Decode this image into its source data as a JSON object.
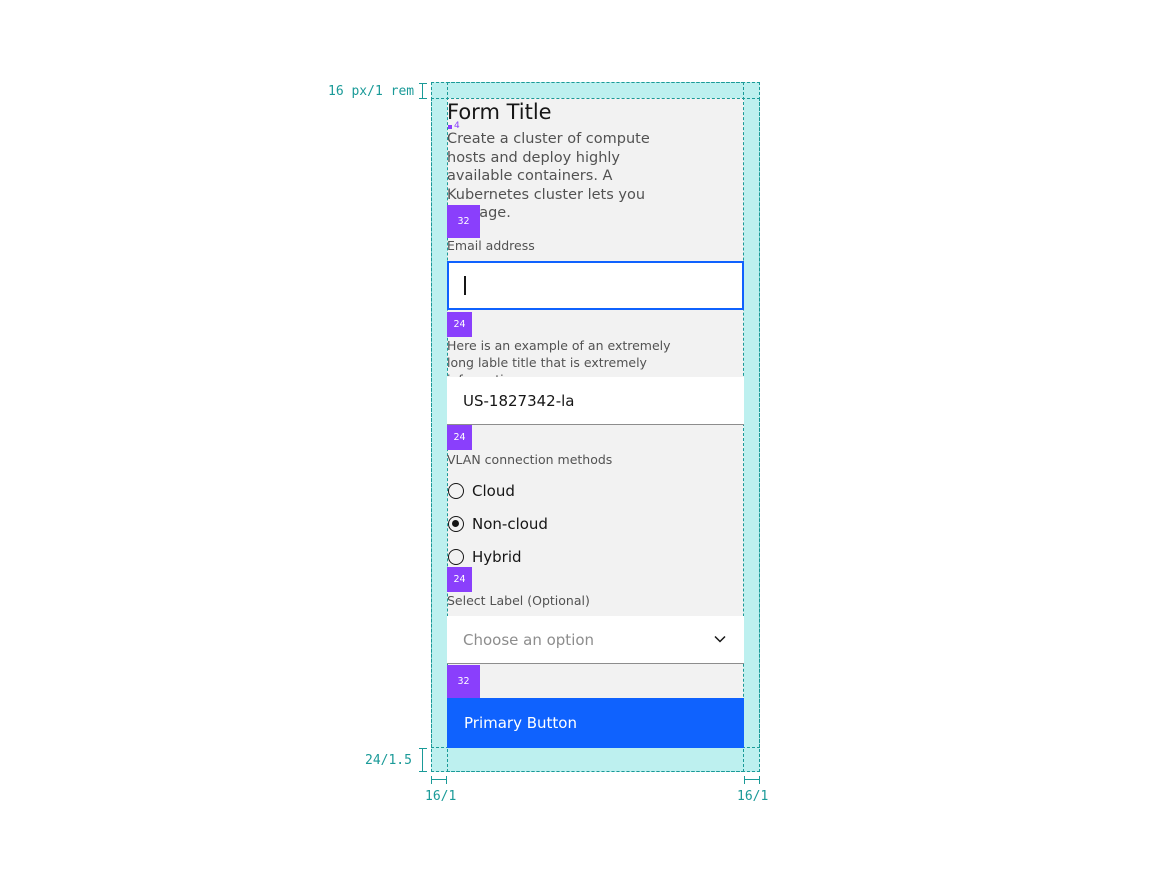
{
  "annotations": {
    "top_padding": "16 px/1 rem",
    "bottom_padding": "24/1.5",
    "left_padding": "16/1",
    "right_padding": "16/1"
  },
  "spacers": {
    "title_gap": "4",
    "after_description": "32",
    "after_email": "24",
    "after_text_input": "24",
    "after_radio": "24",
    "before_button": "32"
  },
  "form": {
    "title": "Form Title",
    "description": "Create a cluster of compute hosts and deploy highly available containers. A Kubernetes cluster lets you manage.",
    "email": {
      "label": "Email address",
      "value": ""
    },
    "text_input": {
      "label": "Here is an example of an extremely long lable title that is extremely informative",
      "value": "US-1827342-la"
    },
    "radio_group": {
      "label": "VLAN connection methods",
      "options": [
        {
          "label": "Cloud",
          "checked": false
        },
        {
          "label": "Non-cloud",
          "checked": true
        },
        {
          "label": "Hybrid",
          "checked": false
        }
      ]
    },
    "select": {
      "label": "Select Label (Optional)",
      "placeholder": "Choose an option",
      "icon": "chevron-down-icon"
    },
    "primary_button": "Primary Button"
  },
  "colors": {
    "spacing_annotation": "#1a9a98",
    "spacer_marker": "#8a3ffc",
    "primary": "#0f62fe",
    "focus": "#0f62fe",
    "form_background": "#f2f2f2"
  }
}
